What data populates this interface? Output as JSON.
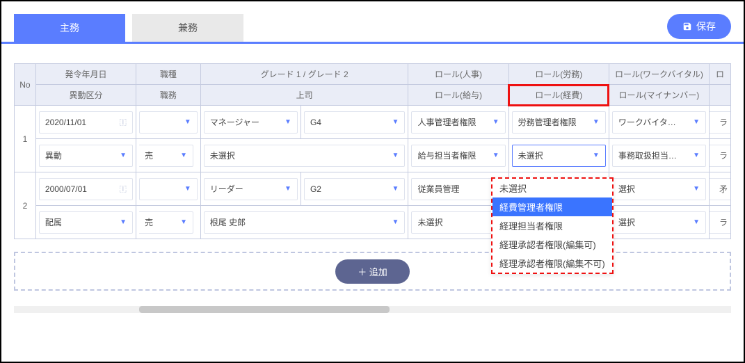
{
  "tabs": {
    "main": "主務",
    "sub": "兼務"
  },
  "save_label": "保存",
  "headers": {
    "no": "No",
    "date": "発令年月日",
    "jobType": "職種",
    "grade": "グレード 1 / グレード 2",
    "roleHr": "ロール(人事)",
    "roleLabor": "ロール(労務)",
    "roleWv": "ロール(ワークバイタル)",
    "tailTop": "ロ",
    "transferType": "異動区分",
    "jobDuty": "職務",
    "superior": "上司",
    "roleSalary": "ロール(給与)",
    "roleExpense": "ロール(経費)",
    "roleMyNum": "ロール(マイナンバー)",
    "tailBot": ""
  },
  "rows": [
    {
      "no": "1",
      "date": "2020/11/01",
      "jobType": "",
      "grade1": "マネージャー",
      "grade2": "G4",
      "roleHr": "人事管理者権限",
      "roleLabor": "労務管理者権限",
      "roleWv": "ワークバイタ…",
      "tailTop": "ラ",
      "transferType": "異動",
      "jobDuty": "売",
      "superior": "未選択",
      "roleSalary": "給与担当者権限",
      "roleExpense": "未選択",
      "roleMyNum": "事務取扱担当…",
      "tailBot": "ラ"
    },
    {
      "no": "2",
      "date": "2000/07/01",
      "jobType": "",
      "grade1": "リーダー",
      "grade2": "G2",
      "roleHr": "従業員管理",
      "roleLabor": "",
      "roleWv": "選択",
      "tailTop": "矛",
      "transferType": "配属",
      "jobDuty": "売",
      "superior": "根尾 史郎",
      "roleSalary": "未選択",
      "roleExpense": "",
      "roleMyNum": "選択",
      "tailBot": "ラ"
    }
  ],
  "dropdown": {
    "options": [
      "未選択",
      "経費管理者権限",
      "経理担当者権限",
      "経理承認者権限(編集可)",
      "経理承認者権限(編集不可)"
    ],
    "selected_index": 1
  },
  "add_label": "＋ 追加"
}
